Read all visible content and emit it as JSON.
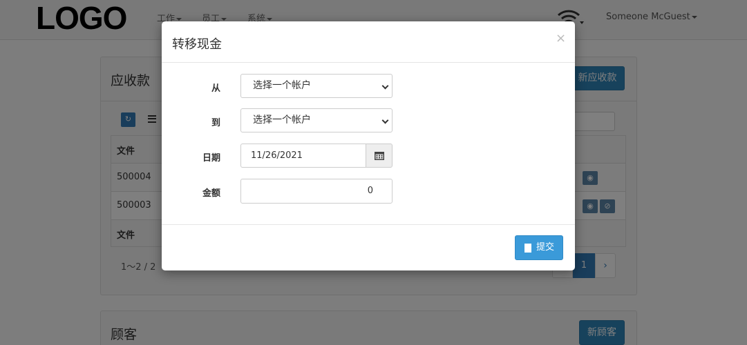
{
  "navbar": {
    "logo": "LOGO",
    "menus": [
      "工作",
      "员工",
      "系统"
    ],
    "user": "Someone McGuest"
  },
  "receivables": {
    "title": "应收款",
    "new_button": "新应收款",
    "table": {
      "header": "文件",
      "rows": [
        "500004",
        "500003"
      ],
      "footer": "文件"
    },
    "pagination": {
      "summary": "1～2 / 2",
      "current_page": "1",
      "next": "›"
    }
  },
  "customers": {
    "title": "顾客",
    "new_button": "新顾客"
  },
  "modal": {
    "title": "转移现金",
    "close": "×",
    "from_label": "从",
    "from_value": "选择一个帐户",
    "to_label": "到",
    "to_value": "选择一个帐户",
    "date_label": "日期",
    "date_value": "11/26/2021",
    "amount_label": "金额",
    "amount_value": "0",
    "submit": "提交"
  }
}
